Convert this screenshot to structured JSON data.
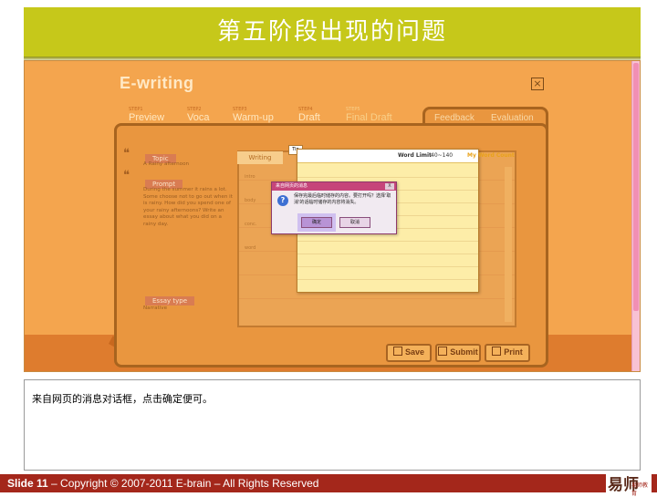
{
  "slide": {
    "title": "第五阶段出现的问题",
    "notes": "来自网页的消息对话框，点击确定便可。",
    "footer_number": "Slide 11",
    "footer_text": " – Copyright © 2007-2011 E-brain – All Rights Reserved",
    "logo_text": "易师",
    "logo_subtext": "易师教育"
  },
  "app": {
    "logo": "E-writing",
    "steps": [
      {
        "small": "STEP1",
        "label": "Preview"
      },
      {
        "small": "STEP2",
        "label": "Voca"
      },
      {
        "small": "STEP3",
        "label": "Warm-up"
      },
      {
        "small": "STEP4",
        "label": "Draft"
      },
      {
        "small": "STEP5",
        "label": "Final Draft"
      }
    ],
    "right_tabs": [
      "Feedback",
      "Evaluation"
    ],
    "topic_label": "Topic",
    "topic_text": "A Rainy afternoon",
    "prompt_label": "Prompt",
    "prompt_text": "During the summer it rains a lot. Some choose not to go out when it is rainy. How did you spend one of your rainy afternoons? Write an essay about what you did on a rainy day.",
    "type_label": "Essay type",
    "type_text": "Narrative",
    "writing_tab": "Writing",
    "line_labels": [
      "intro",
      "body",
      "conc.",
      "word"
    ],
    "tip_label": "Tip",
    "word_limit_label": "Word Limit",
    "word_limit_value": "40~140",
    "my_word_count": "My Word Count",
    "buttons": {
      "save": "Save",
      "submit": "Submit",
      "print": "Print"
    }
  },
  "dialog": {
    "title": "来自网页的消息",
    "message": "保存完最后临时储存的内容。要打开吗？选择'取消'的话临时储存的内容将消失。",
    "ok": "确定",
    "cancel": "取消",
    "close": "X",
    "icon": "question-icon"
  }
}
